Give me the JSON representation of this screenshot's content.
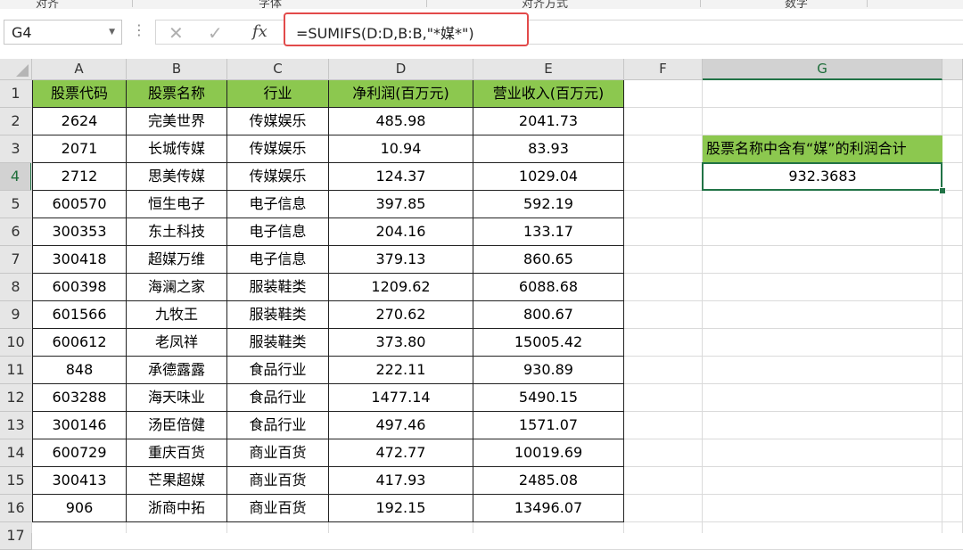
{
  "ribbon": {
    "fragments": [
      "对齐",
      "字体",
      "对齐方式",
      "数字"
    ]
  },
  "formula_bar": {
    "name_box": "G4",
    "fx_label": "fx",
    "cancel_label": "✕",
    "enter_label": "✓",
    "formula": "=SUMIFS(D:D,B:B,\"*媒*\")"
  },
  "columns": [
    "A",
    "B",
    "C",
    "D",
    "E",
    "F",
    "G"
  ],
  "rows": [
    "1",
    "2",
    "3",
    "4",
    "5",
    "6",
    "7",
    "8",
    "9",
    "10",
    "11",
    "12",
    "13",
    "14",
    "15",
    "16",
    "17"
  ],
  "table": {
    "headers": [
      "股票代码",
      "股票名称",
      "行业",
      "净利润(百万元)",
      "营业收入(百万元)"
    ],
    "rows": [
      [
        "2624",
        "完美世界",
        "传媒娱乐",
        "485.98",
        "2041.73"
      ],
      [
        "2071",
        "长城传媒",
        "传媒娱乐",
        "10.94",
        "83.93"
      ],
      [
        "2712",
        "思美传媒",
        "传媒娱乐",
        "124.37",
        "1029.04"
      ],
      [
        "600570",
        "恒生电子",
        "电子信息",
        "397.85",
        "592.19"
      ],
      [
        "300353",
        "东土科技",
        "电子信息",
        "204.16",
        "133.17"
      ],
      [
        "300418",
        "超媒万维",
        "电子信息",
        "379.13",
        "860.65"
      ],
      [
        "600398",
        "海澜之家",
        "服装鞋类",
        "1209.62",
        "6088.68"
      ],
      [
        "601566",
        "九牧王",
        "服装鞋类",
        "270.62",
        "800.67"
      ],
      [
        "600612",
        "老凤祥",
        "服装鞋类",
        "373.80",
        "15005.42"
      ],
      [
        "848",
        "承德露露",
        "食品行业",
        "222.11",
        "930.89"
      ],
      [
        "603288",
        "海天味业",
        "食品行业",
        "1477.14",
        "5490.15"
      ],
      [
        "300146",
        "汤臣倍健",
        "食品行业",
        "497.46",
        "1571.07"
      ],
      [
        "600729",
        "重庆百货",
        "商业百货",
        "472.77",
        "10019.69"
      ],
      [
        "300413",
        "芒果超媒",
        "商业百货",
        "417.93",
        "2485.08"
      ],
      [
        "906",
        "浙商中拓",
        "商业百货",
        "192.15",
        "13496.07"
      ]
    ]
  },
  "summary": {
    "label": "股票名称中含有“媒”的利润合计",
    "value": "932.3683"
  },
  "colors": {
    "header_fill": "#8cc84f",
    "selection": "#217346",
    "formula_highlight": "#e24a4a"
  }
}
